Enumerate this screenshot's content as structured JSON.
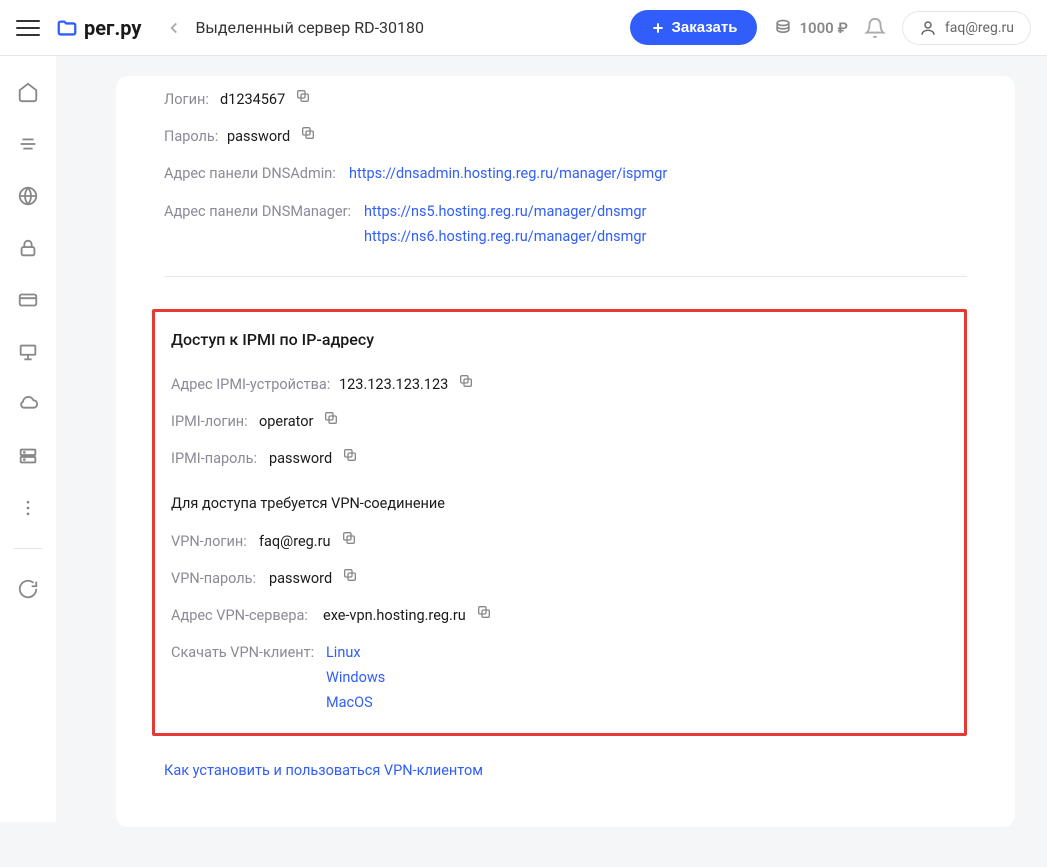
{
  "header": {
    "logo_text": "рег.ру",
    "page_title": "Выделенный сервер RD-30180",
    "order_label": "Заказать",
    "balance": "1000 ₽",
    "user_email": "faq@reg.ru"
  },
  "auth": {
    "login_label": "Логин:",
    "login_value": "d1234567",
    "password_label": "Пароль:",
    "password_value": "password",
    "dnsadmin_label": "Адрес панели DNSAdmin:",
    "dnsadmin_url": "https://dnsadmin.hosting.reg.ru/manager/ispmgr",
    "dnsmanager_label": "Адрес панели DNSManager:",
    "dnsmanager_url1": "https://ns5.hosting.reg.ru/manager/dnsmgr",
    "dnsmanager_url2": "https://ns6.hosting.reg.ru/manager/dnsmgr"
  },
  "ipmi": {
    "title": "Доступ к IPMI по IP-адресу",
    "addr_label": "Адрес IPMI-устройства:",
    "addr_value": "123.123.123.123",
    "login_label": "IPMI-логин:",
    "login_value": "operator",
    "password_label": "IPMI-пароль:",
    "password_value": "password",
    "vpn_note": "Для доступа требуется VPN-соединение",
    "vpn_login_label": "VPN-логин:",
    "vpn_login_value": "faq@reg.ru",
    "vpn_password_label": "VPN-пароль:",
    "vpn_password_value": "password",
    "vpn_server_label": "Адрес VPN-сервера:",
    "vpn_server_value": "exe-vpn.hosting.reg.ru",
    "vpn_client_label": "Скачать VPN-клиент:",
    "vpn_client_linux": "Linux",
    "vpn_client_windows": "Windows",
    "vpn_client_macos": "MacOS"
  },
  "help_link": "Как установить и пользоваться VPN-клиентом"
}
